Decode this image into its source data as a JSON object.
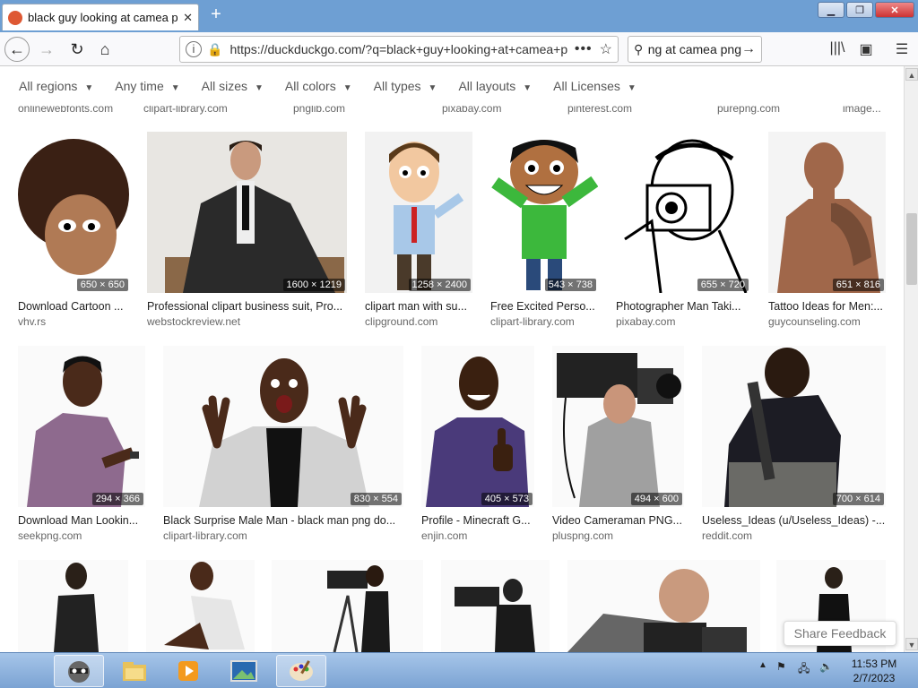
{
  "browser": {
    "tab_title": "black guy looking at camea png at DuckDuckGo",
    "url": "https://duckduckgo.com/?q=black+guy+looking+at+camea+png&iax=images&ia=images",
    "search_text": "black guy looking at camea png"
  },
  "filters": [
    "All regions",
    "Any time",
    "All sizes",
    "All colors",
    "All types",
    "All layouts",
    "All Licenses"
  ],
  "top_sources": [
    "onlinewebfonts.com",
    "clipart-library.com",
    "pnglib.com",
    "pixabay.com",
    "pinterest.com",
    "purepng.com",
    "image..."
  ],
  "row1": [
    {
      "dims": "650 × 650",
      "caption": "Download Cartoon ...",
      "source": "vhv.rs"
    },
    {
      "dims": "1600 × 1219",
      "caption": "Professional clipart business suit, Pro...",
      "source": "webstockreview.net"
    },
    {
      "dims": "1258 × 2400",
      "caption": "clipart man with su...",
      "source": "clipground.com"
    },
    {
      "dims": "543 × 738",
      "caption": "Free Excited Perso...",
      "source": "clipart-library.com"
    },
    {
      "dims": "655 × 720",
      "caption": "Photographer Man Taki...",
      "source": "pixabay.com"
    },
    {
      "dims": "651 × 816",
      "caption": "Tattoo Ideas for Men:...",
      "source": "guycounseling.com"
    }
  ],
  "row2": [
    {
      "dims": "294 × 366",
      "caption": "Download Man Lookin...",
      "source": "seekpng.com"
    },
    {
      "dims": "830 × 554",
      "caption": "Black Surprise Male Man - black man png do...",
      "source": "clipart-library.com"
    },
    {
      "dims": "405 × 573",
      "caption": "Profile - Minecraft G...",
      "source": "enjin.com"
    },
    {
      "dims": "494 × 600",
      "caption": "Video Cameraman PNG...",
      "source": "pluspng.com"
    },
    {
      "dims": "700 × 614",
      "caption": "Useless_Ideas (u/Useless_Ideas) -...",
      "source": "reddit.com"
    }
  ],
  "share_feedback": "Share Feedback",
  "clock": {
    "time": "11:53 PM",
    "date": "2/7/2023"
  }
}
